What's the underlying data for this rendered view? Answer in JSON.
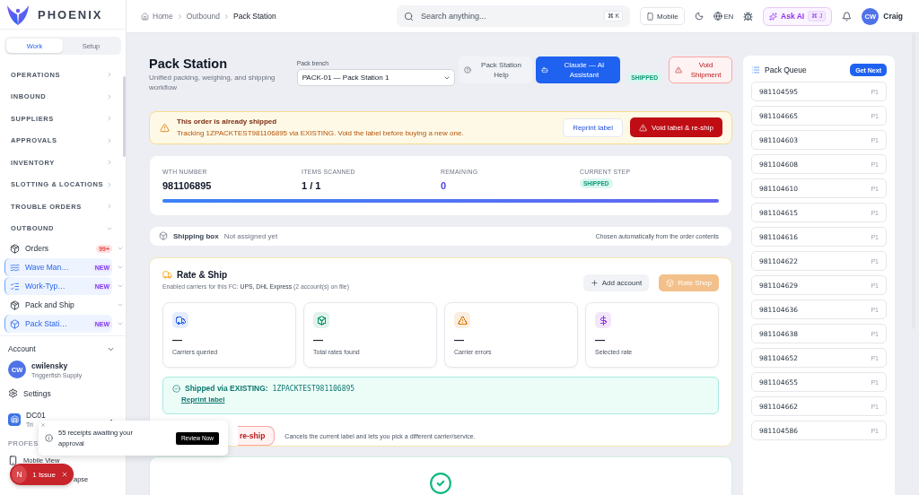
{
  "brand": {
    "name": "PHOENIX"
  },
  "sidebar": {
    "tabs": [
      {
        "label": "Work",
        "selected": true
      },
      {
        "label": "Setup",
        "selected": false
      }
    ],
    "sections": [
      {
        "label": "OPERATIONS",
        "expanded": false
      },
      {
        "label": "INBOUND",
        "expanded": false
      },
      {
        "label": "SUPPLIERS",
        "expanded": false
      },
      {
        "label": "APPROVALS",
        "expanded": false
      },
      {
        "label": "INVENTORY",
        "expanded": false
      },
      {
        "label": "SLOTTING & LOCATIONS",
        "expanded": false
      },
      {
        "label": "TROUBLE ORDERS",
        "expanded": false
      },
      {
        "label": "OUTBOUND",
        "expanded": true
      }
    ],
    "items": [
      {
        "label": "Orders",
        "selected": false,
        "badge": {
          "text": "99+",
          "kind": "count"
        }
      },
      {
        "label": "Wave Man…",
        "selected": true,
        "badge": {
          "text": "NEW",
          "kind": "new"
        }
      },
      {
        "label": "Work-Typ…",
        "selected": true,
        "badge": {
          "text": "NEW",
          "kind": "new"
        }
      },
      {
        "label": "Pack and Ship",
        "selected": false
      },
      {
        "label": "Pack Stati…",
        "selected": true,
        "badge": {
          "text": "NEW",
          "kind": "new"
        }
      }
    ],
    "account": {
      "title": "Account",
      "expanded": true,
      "initials": "CW",
      "user": "cwilensky",
      "org": "Triggerfish Supply",
      "settings": "Settings",
      "site": "DC01",
      "site_sub": "Tri",
      "section": "PROFES",
      "mobile": "Mobile View",
      "collapse": "apse"
    }
  },
  "header": {
    "breadcrumb": [
      "Home",
      "Outbound",
      "Pack Station"
    ],
    "search": {
      "placeholder": "Search anything...",
      "shortcut": "⌘ K"
    },
    "mobile": "Mobile",
    "language": "EN",
    "ask_ai": {
      "label": "Ask AI",
      "shortcut": "⌘ J"
    },
    "user": {
      "initials": "CW",
      "name": "Craig"
    }
  },
  "page": {
    "title": "Pack Station",
    "subtitle": "Unified packing, weighing, and shipping workflow",
    "bench": {
      "label": "Pack bench",
      "value": "PACK-01 — Pack Station 1"
    },
    "help": "Pack Station Help",
    "assistant": "Claude — AI Assistant",
    "status": "SHIPPED",
    "void": "Void Shipment",
    "alert": {
      "title": "This order is already shipped",
      "text": "Tracking 1ZPACKTEST981106895 via EXISTING. Void the label before buying a new one.",
      "reprint": "Reprint label",
      "void": "Void label & re-ship"
    },
    "stats": [
      {
        "label": "WTH NUMBER",
        "value": "981106895",
        "kind": "plain"
      },
      {
        "label": "ITEMS SCANNED",
        "value": "1 / 1",
        "kind": "plain"
      },
      {
        "label": "REMAINING",
        "value": "0",
        "kind": "accent"
      },
      {
        "label": "CURRENT STEP",
        "value": "SHIPPED",
        "kind": "badge"
      }
    ],
    "progress": {
      "level": 1
    },
    "shipping_box": {
      "label": "Shipping box",
      "value": "Not assigned yet",
      "note": "Chosen automatically from the order contents"
    },
    "rate": {
      "title": "Rate & Ship",
      "carriers": "Enabled carriers for this FC: **UPS, DHL Express** (2 account(s) on file)",
      "add": "Add account",
      "shop": {
        "label": "Rate Shop",
        "disabled": true
      },
      "metrics": [
        {
          "value": "—",
          "label": "Carriers queried",
          "color": "#2563eb"
        },
        {
          "value": "—",
          "label": "Total rates found",
          "color": "#059669"
        },
        {
          "value": "—",
          "label": "Carrier errors",
          "color": "#d97706"
        },
        {
          "value": "—",
          "label": "Selected rate",
          "color": "#9333ea"
        }
      ],
      "success": {
        "text": "Shipped via EXISTING:",
        "tracking": "1ZPACKTEST981106895",
        "link": "Reprint label"
      },
      "reship": {
        "button": "re-ship",
        "note": "Cancels the current label and lets you pick a different carrier/service."
      }
    }
  },
  "queue": {
    "title": "Pack Queue",
    "action": "Get Next",
    "items": [
      {
        "id": "981104595",
        "priority": "P1"
      },
      {
        "id": "981104665",
        "priority": "P1"
      },
      {
        "id": "981104603",
        "priority": "P1"
      },
      {
        "id": "981104608",
        "priority": "P1"
      },
      {
        "id": "981104610",
        "priority": "P1"
      },
      {
        "id": "981104615",
        "priority": "P1"
      },
      {
        "id": "981104616",
        "priority": "P1"
      },
      {
        "id": "981104622",
        "priority": "P1"
      },
      {
        "id": "981104629",
        "priority": "P1"
      },
      {
        "id": "981104636",
        "priority": "P1"
      },
      {
        "id": "981104638",
        "priority": "P1"
      },
      {
        "id": "981104652",
        "priority": "P1"
      },
      {
        "id": "981104655",
        "priority": "P1"
      },
      {
        "id": "981104662",
        "priority": "P1"
      },
      {
        "id": "981104586",
        "priority": "P1"
      }
    ]
  },
  "toast": {
    "text": "55 receipts awaiting your approval",
    "action": "Review Now"
  },
  "issue": {
    "letter": "N",
    "text": "1 Issue"
  }
}
